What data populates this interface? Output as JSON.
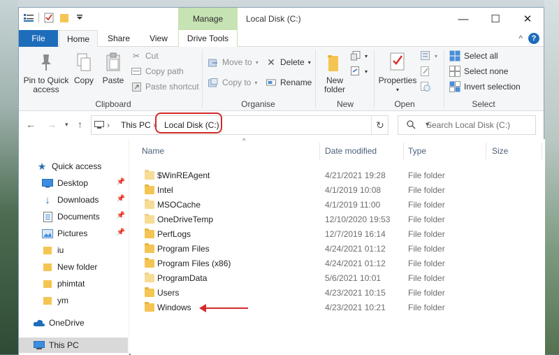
{
  "window": {
    "title": "Local Disk (C:)",
    "manage_label": "Manage",
    "controls": {
      "minimize": "—",
      "maximize": "☐",
      "close": "✕"
    }
  },
  "ribbon_tabs": {
    "file": "File",
    "home": "Home",
    "share": "Share",
    "view": "View",
    "drive_tools": "Drive Tools",
    "collapse": "^",
    "help": "?"
  },
  "clipboard": {
    "pin_line1": "Pin to Quick",
    "pin_line2": "access",
    "copy": "Copy",
    "paste": "Paste",
    "cut": "Cut",
    "copy_path": "Copy path",
    "paste_shortcut": "Paste shortcut",
    "label": "Clipboard"
  },
  "organise": {
    "move_to": "Move to",
    "copy_to": "Copy to",
    "delete": "Delete",
    "rename": "Rename",
    "label": "Organise"
  },
  "new_group": {
    "new_folder_line1": "New",
    "new_folder_line2": "folder",
    "label": "New"
  },
  "open_group": {
    "properties": "Properties",
    "label": "Open"
  },
  "select_group": {
    "select_all": "Select all",
    "select_none": "Select none",
    "invert": "Invert selection",
    "label": "Select"
  },
  "address": {
    "crumbs": [
      "This PC",
      "Local Disk (C:)"
    ],
    "search_placeholder": "Search Local Disk (C:)"
  },
  "nav_pane": {
    "quick_access": "Quick access",
    "items": [
      "Desktop",
      "Downloads",
      "Documents",
      "Pictures",
      "iu",
      "New folder",
      "phimtat",
      "ym"
    ],
    "onedrive": "OneDrive",
    "this_pc": "This PC"
  },
  "columns": {
    "name": "Name",
    "date": "Date modified",
    "type": "Type",
    "size": "Size"
  },
  "files": [
    {
      "name": "$WinREAgent",
      "date": "4/21/2021 19:28",
      "type": "File folder"
    },
    {
      "name": "Intel",
      "date": "4/1/2019 10:08",
      "type": "File folder"
    },
    {
      "name": "MSOCache",
      "date": "4/1/2019 11:00",
      "type": "File folder"
    },
    {
      "name": "OneDriveTemp",
      "date": "12/10/2020 19:53",
      "type": "File folder"
    },
    {
      "name": "PerfLogs",
      "date": "12/7/2019 16:14",
      "type": "File folder"
    },
    {
      "name": "Program Files",
      "date": "4/24/2021 01:12",
      "type": "File folder"
    },
    {
      "name": "Program Files (x86)",
      "date": "4/24/2021 01:12",
      "type": "File folder"
    },
    {
      "name": "ProgramData",
      "date": "5/6/2021 10:01",
      "type": "File folder"
    },
    {
      "name": "Users",
      "date": "4/23/2021 10:15",
      "type": "File folder"
    },
    {
      "name": "Windows",
      "date": "4/23/2021 10:21",
      "type": "File folder"
    }
  ],
  "colors": {
    "accent": "#1e6dbb",
    "manage": "#c6e3b4",
    "annotation": "#d42a2a",
    "folder": "#f5c553"
  }
}
